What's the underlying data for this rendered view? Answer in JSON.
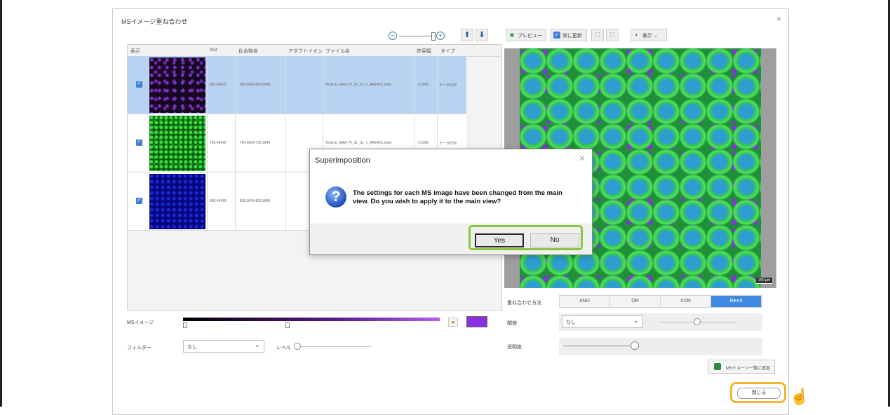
{
  "page_heading": "",
  "window": {
    "title": "MSイメージ重ね合わせ",
    "close_icon": "×"
  },
  "table": {
    "headers": [
      "表示",
      "m/z",
      "化合物名",
      "アダクトイオン",
      "ファイル名",
      "許容幅",
      "タイプ"
    ],
    "rows": [
      {
        "mz": "885.48492",
        "range": "884.9849-885.9849",
        "file": "Testicle_MAA_PI_SL_5x_1_AREA01.imdx",
        "tol": "0.5000",
        "type": "データ行列",
        "thumb": "purple"
      },
      {
        "mz": "795.48492",
        "range": "794.9849-795.9849",
        "file": "Testicle_MAA_PI_SL_5x_1_AREA01.imdx",
        "tol": "0.5000",
        "type": "データ行列",
        "thumb": "green"
      },
      {
        "mz": "809.48492",
        "range": "808.9849-809.9849",
        "file": "",
        "tol": "",
        "type": "",
        "thumb": "blue"
      }
    ]
  },
  "left_controls": {
    "msimage_label": "MSイメージ",
    "filter_label": "フィルター",
    "filter_value": "なし",
    "level_label": "レベル"
  },
  "right_toolbar": {
    "preview": "プレビュー",
    "auto_update": "常に更新",
    "display": "表示"
  },
  "image": {
    "scale_label": "250 μm"
  },
  "right_controls": {
    "method_label": "重ね合わせ方法",
    "methods": [
      "AND",
      "OR",
      "XOR",
      "Blend"
    ],
    "active_method": "Blend",
    "threshold_label": "閾値",
    "threshold_value": "なし",
    "opacity_label": "透明度",
    "add_button": "MSイメージ一覧に追加",
    "close_button": "閉じる"
  },
  "dialog": {
    "title": "Superimposition",
    "message": "The settings for each MS image have been changed from the main view. Do you wish to apply it to the main view?",
    "yes": "Yes",
    "no": "No"
  },
  "colors": {
    "accent": "#3f8ae0",
    "highlight_green": "#8cc63f",
    "highlight_yellow": "#f2b731"
  }
}
